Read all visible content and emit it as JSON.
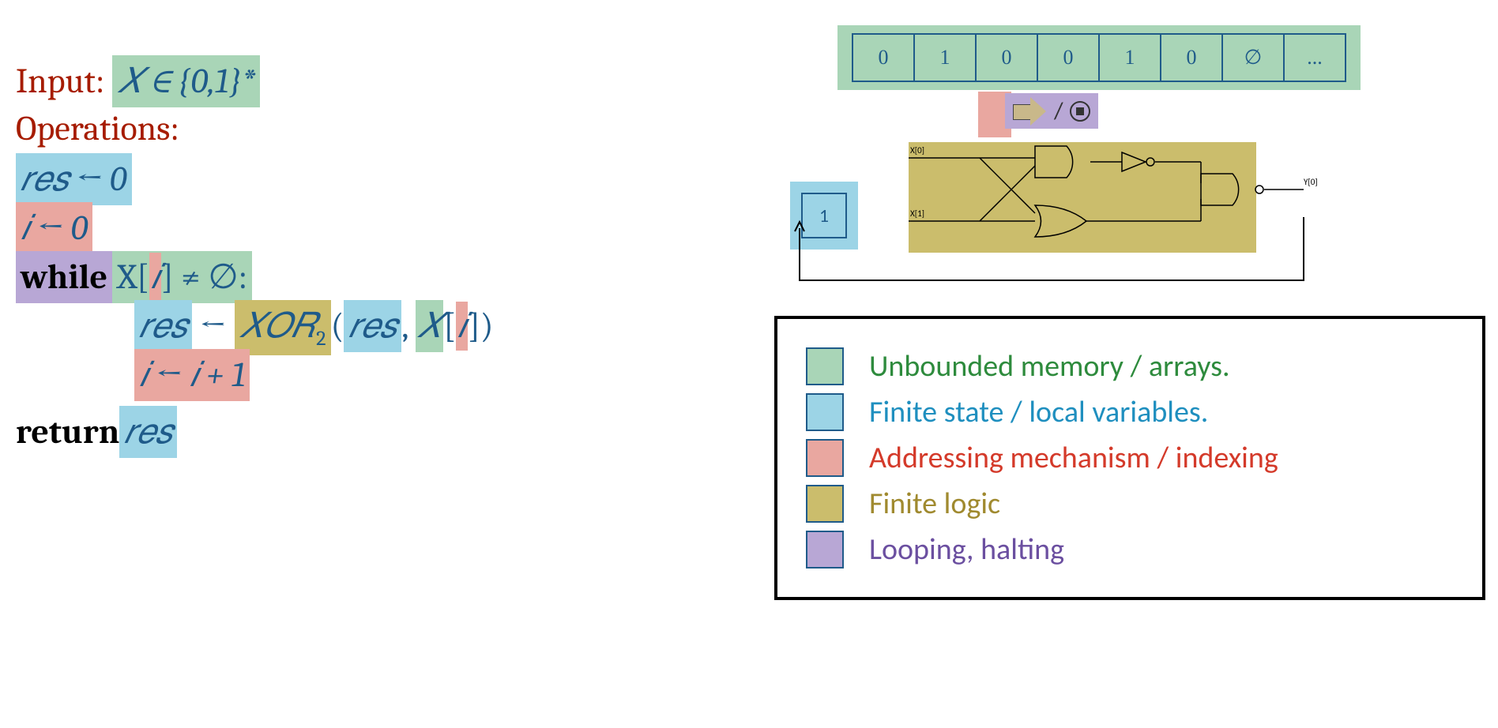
{
  "code": {
    "input_label": "Input:",
    "input_expr": "𝑋 ∈ {0,1}*",
    "ops_label": "Operations:",
    "res_init": "𝑟𝑒𝑠 ← 0",
    "i_init": "𝑖 ← 0",
    "while_kw": "while",
    "while_xpart": "X[",
    "while_i": "𝑖",
    "while_close": "]",
    "while_neq": " ≠ ∅:",
    "assign_res_l": "𝑟𝑒𝑠",
    "assign_arrow": " ← ",
    "xor": "𝑋𝑂𝑅",
    "xor_sub": "2",
    "assign_open": "(",
    "assign_res_arg": "𝑟𝑒𝑠",
    "assign_comma": ", ",
    "assign_X": "𝑋",
    "assign_br_open": "[",
    "assign_i": "𝑖",
    "assign_br_close": "]",
    "assign_close": ")",
    "inc": "𝑖 ← 𝑖 + 1",
    "return_kw": "return",
    "return_val": " 𝑟𝑒𝑠"
  },
  "tape": {
    "cells": [
      "0",
      "1",
      "0",
      "0",
      "1",
      "0",
      "∅",
      "..."
    ]
  },
  "head": {
    "slash": "/"
  },
  "state": {
    "value": "1"
  },
  "circuit": {
    "x0": "X[0]",
    "x1": "X[1]",
    "y0": "Y[0]"
  },
  "legend": {
    "items": [
      {
        "label": "Unbounded memory  / arrays.",
        "colorClass": "c-green",
        "swatchClass": "hl-green"
      },
      {
        "label": "Finite state / local variables.",
        "colorClass": "c-blue",
        "swatchClass": "hl-blue"
      },
      {
        "label": "Addressing mechanism / indexing",
        "colorClass": "c-red",
        "swatchClass": "hl-red"
      },
      {
        "label": "Finite logic",
        "colorClass": "c-yellow",
        "swatchClass": "hl-yellow"
      },
      {
        "label": "Looping, halting",
        "colorClass": "c-purple",
        "swatchClass": "hl-purple"
      }
    ]
  }
}
